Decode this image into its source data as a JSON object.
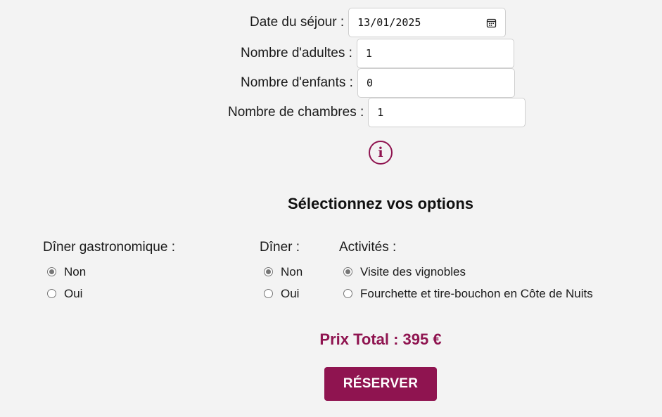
{
  "form": {
    "date": {
      "label": "Date du séjour :",
      "value": "13/01/2025"
    },
    "adults": {
      "label": "Nombre d'adultes :",
      "value": "1"
    },
    "children": {
      "label": "Nombre d'enfants :",
      "value": "0"
    },
    "rooms": {
      "label": "Nombre de chambres :",
      "value": "1"
    }
  },
  "info_icon": {
    "glyph": "i",
    "name": "info-icon",
    "color": "#8f1450"
  },
  "options": {
    "title": "Sélectionnez vos options",
    "gastro": {
      "title": "Dîner gastronomique :",
      "choices": [
        {
          "label": "Non",
          "checked": true
        },
        {
          "label": "Oui",
          "checked": false
        }
      ]
    },
    "diner": {
      "title": "Dîner :",
      "choices": [
        {
          "label": "Non",
          "checked": true
        },
        {
          "label": "Oui",
          "checked": false
        }
      ]
    },
    "activites": {
      "title": "Activités :",
      "choices": [
        {
          "label": "Visite des vignobles",
          "checked": true
        },
        {
          "label": "Fourchette et tire-bouchon en Côte de Nuits",
          "checked": false
        }
      ]
    }
  },
  "total": {
    "text": "Prix Total : 395 €"
  },
  "reserve": {
    "label": "RÉSERVER"
  },
  "colors": {
    "accent": "#8f1450",
    "background": "#f3f3f3"
  }
}
